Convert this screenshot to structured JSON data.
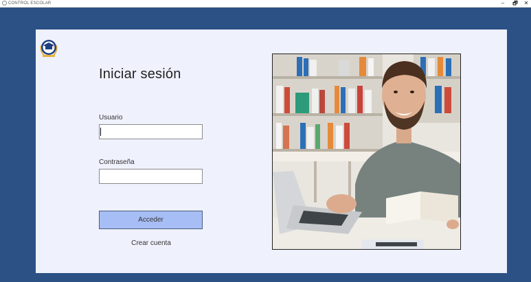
{
  "window": {
    "title": "CONTROL ESCOLAR",
    "minimize_glyph": "–",
    "maximize_glyph": "🗗",
    "close_glyph": "✕"
  },
  "logo": {
    "icon": "graduation-cap-icon"
  },
  "login": {
    "heading": "Iniciar sesión",
    "user_label": "Usuario",
    "user_value": "",
    "password_label": "Contraseña",
    "password_value": "",
    "submit_label": "Acceder",
    "create_account_label": "Crear cuenta"
  },
  "colors": {
    "background": "#2b5185",
    "card": "#eff1fd",
    "button": "#a7bdf5",
    "logo_blue": "#1f3f82",
    "logo_gold": "#e4b23a"
  },
  "photo": {
    "subject": "student-photo"
  }
}
